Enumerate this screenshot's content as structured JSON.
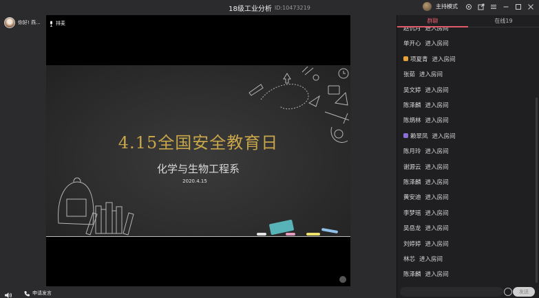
{
  "window": {
    "title": "18级工业分析",
    "room_id": "ID:10473219",
    "host_mode_label": "主持模式"
  },
  "user": {
    "greeting": "你好! 燕..."
  },
  "stage": {
    "top_label": "排麦"
  },
  "slide": {
    "title": "4.15全国安全教育日",
    "subtitle": "化学与生物工程系",
    "date": "2020.4.15"
  },
  "bottom": {
    "apply_label": "申请发言"
  },
  "panel": {
    "tabs": [
      {
        "label": "群聊",
        "active": true
      },
      {
        "label": "在线19",
        "active": false
      }
    ],
    "messages": [
      {
        "name": "赵仉月",
        "action": "进入房间",
        "badge": ""
      },
      {
        "name": "单开心",
        "action": "进入房间",
        "badge": ""
      },
      {
        "name": "项夏青",
        "action": "进入房间",
        "badge": "#e8a23a"
      },
      {
        "name": "张茹",
        "action": "进入房间",
        "badge": ""
      },
      {
        "name": "吴文婷",
        "action": "进入房间",
        "badge": ""
      },
      {
        "name": "陈泽麟",
        "action": "进入房间",
        "badge": ""
      },
      {
        "name": "陈炳林",
        "action": "进入房间",
        "badge": ""
      },
      {
        "name": "赖翠凤",
        "action": "进入房间",
        "badge": "#8e6fd8"
      },
      {
        "name": "陈月玲",
        "action": "进入房间",
        "badge": ""
      },
      {
        "name": "谢源云",
        "action": "进入房间",
        "badge": ""
      },
      {
        "name": "陈泽麟",
        "action": "进入房间",
        "badge": ""
      },
      {
        "name": "黄安迪",
        "action": "进入房间",
        "badge": ""
      },
      {
        "name": "李梦瑶",
        "action": "进入房间",
        "badge": ""
      },
      {
        "name": "吴岳龙",
        "action": "进入房间",
        "badge": ""
      },
      {
        "name": "刘婷婷",
        "action": "进入房间",
        "badge": ""
      },
      {
        "name": "林芯",
        "action": "进入房间",
        "badge": ""
      },
      {
        "name": "陈泽麟",
        "action": "进入房间",
        "badge": ""
      }
    ],
    "send_label": "发送"
  }
}
